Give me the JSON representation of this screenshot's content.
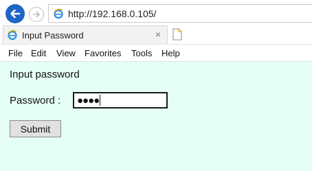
{
  "browser": {
    "url": "http://192.168.0.105/",
    "tab_title": "Input Password",
    "tab_close_glyph": "×",
    "icons": [
      "back-arrow-icon",
      "forward-arrow-icon",
      "internet-explorer-icon",
      "close-icon",
      "new-tab-icon"
    ]
  },
  "menu": {
    "items": [
      "File",
      "Edit",
      "View",
      "Favorites",
      "Tools",
      "Help"
    ]
  },
  "page": {
    "heading": "Input password",
    "password_label": "Password :",
    "password_value_masked": "●●●●",
    "submit_label": "Submit",
    "background_color": "#e6fff6"
  }
}
